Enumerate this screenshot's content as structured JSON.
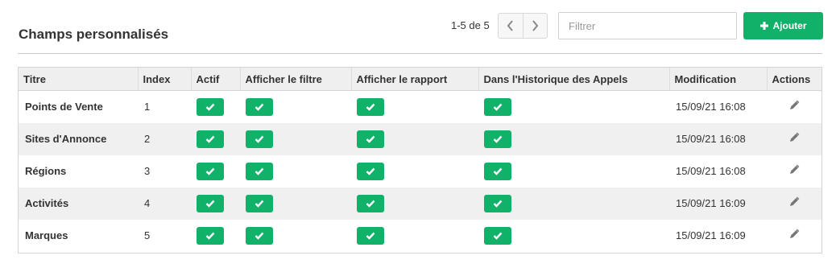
{
  "header": {
    "title": "Champs personnalisés",
    "pagination": "1-5 de 5",
    "filter_placeholder": "Filtrer",
    "add_label": "Ajouter"
  },
  "icons": {
    "prev": "chevron-left-icon",
    "next": "chevron-right-icon",
    "add": "plus-icon",
    "check": "check-icon",
    "edit": "pencil-icon"
  },
  "colors": {
    "accent": "#12b16a"
  },
  "table": {
    "columns": [
      "Titre",
      "Index",
      "Actif",
      "Afficher le filtre",
      "Afficher le rapport",
      "Dans l'Historique des Appels",
      "Modification",
      "Actions"
    ],
    "rows": [
      {
        "titre": "Points de Vente",
        "index": "1",
        "actif": true,
        "filtre": true,
        "rapport": true,
        "historique": true,
        "modification": "15/09/21 16:08"
      },
      {
        "titre": "Sites d'Annonce",
        "index": "2",
        "actif": true,
        "filtre": true,
        "rapport": true,
        "historique": true,
        "modification": "15/09/21 16:08"
      },
      {
        "titre": "Régions",
        "index": "3",
        "actif": true,
        "filtre": true,
        "rapport": true,
        "historique": true,
        "modification": "15/09/21 16:08"
      },
      {
        "titre": "Activités",
        "index": "4",
        "actif": true,
        "filtre": true,
        "rapport": true,
        "historique": true,
        "modification": "15/09/21 16:09"
      },
      {
        "titre": "Marques",
        "index": "5",
        "actif": true,
        "filtre": true,
        "rapport": true,
        "historique": true,
        "modification": "15/09/21 16:09"
      }
    ]
  }
}
